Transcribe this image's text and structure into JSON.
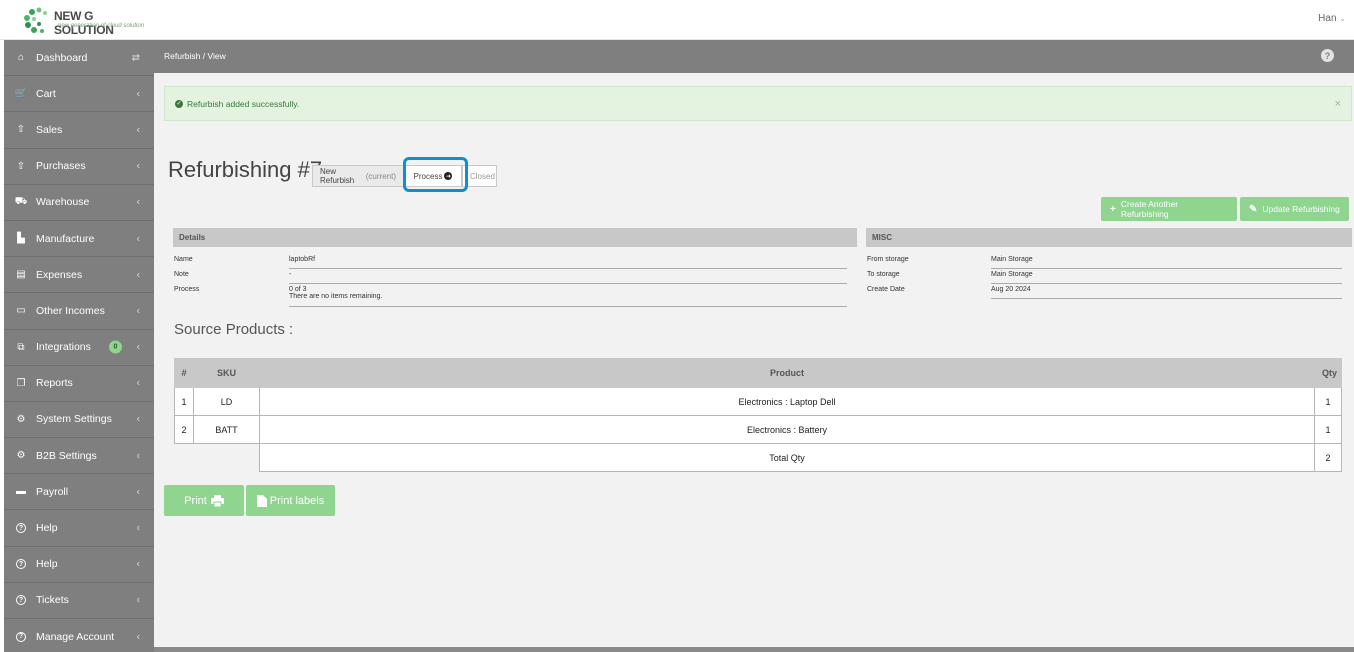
{
  "brand": {
    "name": "NEW G SOLUTION",
    "tagline": "new generation of cloud solution"
  },
  "user": {
    "name": "Han"
  },
  "sidebar": {
    "items": [
      {
        "label": "Dashboard",
        "icon": "home-icon",
        "trailing": "⇄"
      },
      {
        "label": "Cart",
        "icon": "cart-icon",
        "trailing": "‹"
      },
      {
        "label": "Sales",
        "icon": "upload-icon",
        "trailing": "‹"
      },
      {
        "label": "Purchases",
        "icon": "upload-icon",
        "trailing": "‹"
      },
      {
        "label": "Warehouse",
        "icon": "truck-icon",
        "trailing": "‹"
      },
      {
        "label": "Manufacture",
        "icon": "factory-icon",
        "trailing": "‹"
      },
      {
        "label": "Expenses",
        "icon": "file-icon",
        "trailing": "‹"
      },
      {
        "label": "Other Incomes",
        "icon": "money-icon",
        "trailing": "‹"
      },
      {
        "label": "Integrations",
        "icon": "integration-icon",
        "trailing": "‹",
        "badge": "0"
      },
      {
        "label": "Reports",
        "icon": "copy-icon",
        "trailing": "‹"
      },
      {
        "label": "System Settings",
        "icon": "gears-icon",
        "trailing": "‹"
      },
      {
        "label": "B2B Settings",
        "icon": "gears-icon",
        "trailing": "‹"
      },
      {
        "label": "Payroll",
        "icon": "card-icon",
        "trailing": "‹"
      },
      {
        "label": "Help",
        "icon": "question-icon",
        "trailing": "‹"
      },
      {
        "label": "Help",
        "icon": "question-icon",
        "trailing": "‹"
      },
      {
        "label": "Tickets",
        "icon": "question-icon",
        "trailing": "‹"
      },
      {
        "label": "Manage Account",
        "icon": "question-icon",
        "trailing": "‹"
      }
    ]
  },
  "breadcrumb": "Refurbish  /  View",
  "alert": {
    "text": "Refurbish added successfully.",
    "close": "×"
  },
  "page": {
    "title": "Refurbishing #7",
    "steps": {
      "new": "New Refurbish",
      "current": "(current)",
      "process": "Process",
      "closed": "Closed"
    },
    "buttons": {
      "create_another": "Create Another Refurbishing",
      "update": "Update Refurbishing"
    }
  },
  "details": {
    "heading": "Details",
    "name_label": "Name",
    "name_value": "laptobRf",
    "note_label": "Note",
    "note_value": "-",
    "process_label": "Process",
    "process_value": "0 of 3",
    "process_note": "There are no items remaining."
  },
  "misc": {
    "heading": "MISC",
    "from_label": "From storage",
    "from_value": "Main Storage",
    "to_label": "To storage",
    "to_value": "Main Storage",
    "date_label": "Create Date",
    "date_value": "Aug 20 2024"
  },
  "source": {
    "title": "Source Products :",
    "headers": [
      "#",
      "SKU",
      "Product",
      "Qty"
    ],
    "rows": [
      [
        "1",
        "LD",
        "Electronics : Laptop Dell",
        "1"
      ],
      [
        "2",
        "BATT",
        "Electronics : Battery",
        "1"
      ]
    ],
    "total_label": "Total Qty",
    "total_value": "2"
  },
  "actions": {
    "print": "Print",
    "print_labels": "Print labels"
  },
  "colors": {
    "sidebar": "#7f7f7f",
    "accent_green": "#8fd48f",
    "highlight": "#0b8fd6"
  }
}
